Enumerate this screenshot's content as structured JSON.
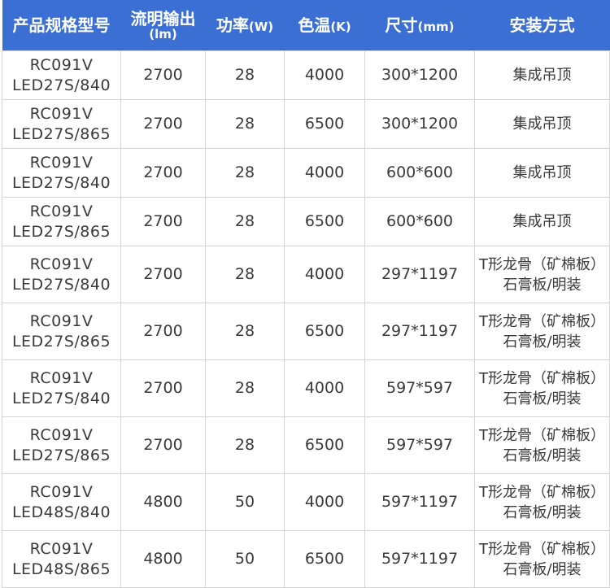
{
  "header": {
    "model": "产品规格型号",
    "flux": "流明输出",
    "flux_unit": "(lm)",
    "power": "功率",
    "power_unit": "(W)",
    "cct": "色温",
    "cct_unit": "(K)",
    "size": "尺寸",
    "size_unit": "(mm)",
    "install": "安装方式"
  },
  "rows": [
    {
      "model_1": "RC091V",
      "model_2": "LED27S/840",
      "flux": "2700",
      "power": "28",
      "cct": "4000",
      "size": "300*1200",
      "install_1": "集成吊顶",
      "install_2": ""
    },
    {
      "model_1": "RC091V",
      "model_2": "LED27S/865",
      "flux": "2700",
      "power": "28",
      "cct": "6500",
      "size": "300*1200",
      "install_1": "集成吊顶",
      "install_2": ""
    },
    {
      "model_1": "RC091V",
      "model_2": "LED27S/840",
      "flux": "2700",
      "power": "28",
      "cct": "4000",
      "size": "600*600",
      "install_1": "集成吊顶",
      "install_2": ""
    },
    {
      "model_1": "RC091V",
      "model_2": "LED27S/865",
      "flux": "2700",
      "power": "28",
      "cct": "6500",
      "size": "600*600",
      "install_1": "集成吊顶",
      "install_2": ""
    },
    {
      "model_1": "RC091V",
      "model_2": "LED27S/840",
      "flux": "2700",
      "power": "28",
      "cct": "4000",
      "size": "297*1197",
      "install_1": "T形龙骨（矿棉板）",
      "install_2": "石膏板/明装"
    },
    {
      "model_1": "RC091V",
      "model_2": "LED27S/865",
      "flux": "2700",
      "power": "28",
      "cct": "6500",
      "size": "297*1197",
      "install_1": "T形龙骨（矿棉板）",
      "install_2": "石膏板/明装"
    },
    {
      "model_1": "RC091V",
      "model_2": "LED27S/840",
      "flux": "2700",
      "power": "28",
      "cct": "4000",
      "size": "597*597",
      "install_1": "T形龙骨（矿棉板）",
      "install_2": "石膏板/明装"
    },
    {
      "model_1": "RC091V",
      "model_2": "LED27S/865",
      "flux": "2700",
      "power": "28",
      "cct": "6500",
      "size": "597*597",
      "install_1": "T形龙骨（矿棉板）",
      "install_2": "石膏板/明装"
    },
    {
      "model_1": "RC091V",
      "model_2": "LED48S/840",
      "flux": "4800",
      "power": "50",
      "cct": "4000",
      "size": "597*1197",
      "install_1": "T形龙骨（矿棉板）",
      "install_2": "石膏板/明装"
    },
    {
      "model_1": "RC091V",
      "model_2": "LED48S/865",
      "flux": "4800",
      "power": "50",
      "cct": "6500",
      "size": "597*1197",
      "install_1": "T形龙骨（矿棉板）",
      "install_2": "石膏板/明装"
    }
  ]
}
